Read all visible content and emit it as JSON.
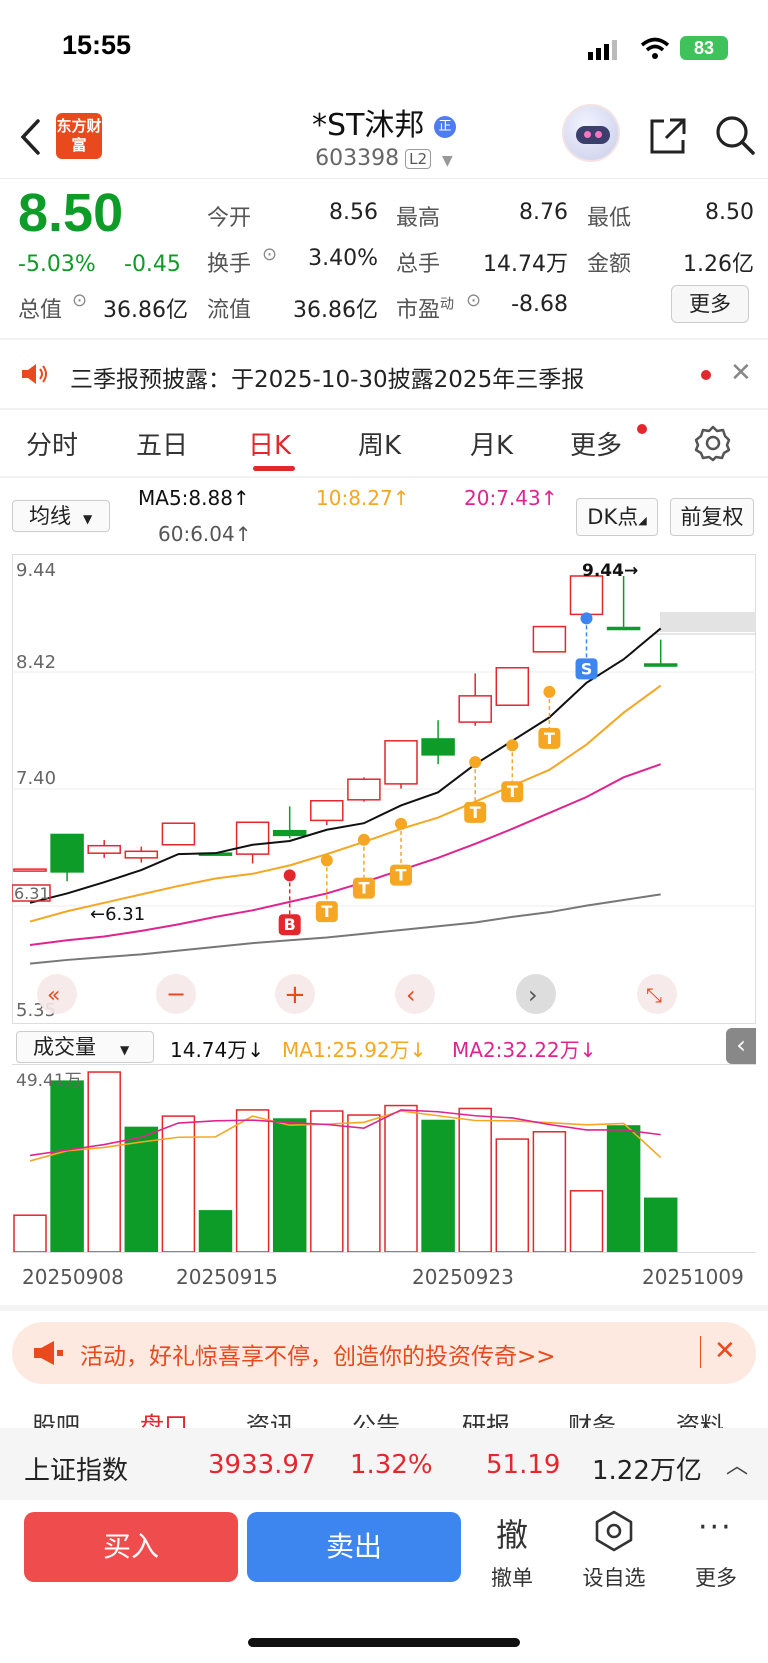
{
  "status_bar": {
    "time": "15:55",
    "battery": "83"
  },
  "header": {
    "logo_text": "东方财富",
    "title": "*ST沐邦",
    "code": "603398",
    "level_badge": "L2"
  },
  "quote": {
    "price": "8.50",
    "change_pct": "-5.03%",
    "change": "-0.45",
    "open_label": "今开",
    "open": "8.56",
    "high_label": "最高",
    "high": "8.76",
    "low_label": "最低",
    "low": "8.50",
    "turnover_label": "换手",
    "turnover": "3.40%",
    "volume_label": "总手",
    "volume": "14.74万",
    "amount_label": "金额",
    "amount": "1.26亿",
    "mktcap_label": "总值",
    "mktcap": "36.86亿",
    "float_label": "流值",
    "float": "36.86亿",
    "pe_label": "市盈",
    "pe_sup": "动",
    "pe": "-8.68",
    "more_label": "更多"
  },
  "notice": {
    "text": "三季报预披露：于2025-10-30披露2025年三季报"
  },
  "tabs": [
    {
      "label": "分时"
    },
    {
      "label": "五日"
    },
    {
      "label": "日K"
    },
    {
      "label": "周K"
    },
    {
      "label": "月K"
    },
    {
      "label": "更多"
    }
  ],
  "kline_toolbar": {
    "ma_select": "均线",
    "ma5": "MA5:8.88↑",
    "ma10": "10:8.27↑",
    "ma20": "20:7.43↑",
    "ma60": "60:6.04↑",
    "dk_button": "DK点",
    "adjust_button": "前复权"
  },
  "kline_labels": {
    "y_top": "9.44",
    "y_2": "8.42",
    "y_3": "7.40",
    "y_bottom": "5.35",
    "y_left_marker": "6.31",
    "min_marker": "←6.31",
    "max_marker": "9.44→"
  },
  "volume_toolbar": {
    "select": "成交量",
    "vol": "14.74万↓",
    "ma1": "MA1:25.92万↓",
    "ma2": "MA2:32.22万↓",
    "vol_max": "49.41万"
  },
  "dates": [
    "20250908",
    "20250915",
    "20250923",
    "20251009"
  ],
  "colors": {
    "up": "#e4262d",
    "down": "#0d9c27",
    "ma5": "#111111",
    "ma10": "#f5a623",
    "ma20": "#e0248f",
    "ma60": "#777777"
  },
  "chart_data": {
    "type": "candlestick",
    "ylim": [
      5.35,
      9.44
    ],
    "candles": [
      {
        "o": 6.31,
        "c": 6.31,
        "h": 6.31,
        "l": 6.31,
        "dir": "up"
      },
      {
        "o": 6.68,
        "c": 6.28,
        "h": 6.68,
        "l": 6.18,
        "dir": "down"
      },
      {
        "o": 6.48,
        "c": 6.56,
        "h": 6.62,
        "l": 6.43,
        "dir": "up"
      },
      {
        "o": 6.43,
        "c": 6.5,
        "h": 6.55,
        "l": 6.38,
        "dir": "up"
      },
      {
        "o": 6.57,
        "c": 6.8,
        "h": 6.8,
        "l": 6.57,
        "dir": "up"
      },
      {
        "o": 6.48,
        "c": 6.48,
        "h": 6.48,
        "l": 6.48,
        "dir": "down"
      },
      {
        "o": 6.47,
        "c": 6.81,
        "h": 6.81,
        "l": 6.37,
        "dir": "up"
      },
      {
        "o": 6.72,
        "c": 6.67,
        "h": 6.98,
        "l": 6.64,
        "dir": "down"
      },
      {
        "o": 6.83,
        "c": 7.04,
        "h": 7.04,
        "l": 6.78,
        "dir": "up"
      },
      {
        "o": 7.05,
        "c": 7.27,
        "h": 7.29,
        "l": 7.03,
        "dir": "up"
      },
      {
        "o": 7.22,
        "c": 7.68,
        "h": 7.68,
        "l": 7.17,
        "dir": "up"
      },
      {
        "o": 7.7,
        "c": 7.53,
        "h": 7.9,
        "l": 7.43,
        "dir": "down"
      },
      {
        "o": 7.88,
        "c": 8.16,
        "h": 8.4,
        "l": 7.84,
        "dir": "up"
      },
      {
        "o": 8.06,
        "c": 8.46,
        "h": 8.46,
        "l": 8.06,
        "dir": "up"
      },
      {
        "o": 8.63,
        "c": 8.9,
        "h": 8.9,
        "l": 8.63,
        "dir": "up"
      },
      {
        "o": 9.03,
        "c": 9.44,
        "h": 9.44,
        "l": 9.03,
        "dir": "up"
      },
      {
        "o": 8.89,
        "c": 8.89,
        "h": 9.44,
        "l": 8.89,
        "dir": "down"
      },
      {
        "o": 8.5,
        "c": 8.5,
        "h": 8.76,
        "l": 8.5,
        "dir": "down"
      }
    ],
    "ma5": [
      5.95,
      6.05,
      6.17,
      6.3,
      6.47,
      6.48,
      6.57,
      6.61,
      6.73,
      6.8,
      6.99,
      7.13,
      7.43,
      7.68,
      7.93,
      8.3,
      8.55,
      8.88
    ],
    "ma10": [
      5.75,
      5.86,
      5.95,
      6.04,
      6.13,
      6.21,
      6.26,
      6.35,
      6.47,
      6.6,
      6.74,
      6.86,
      7.03,
      7.2,
      7.37,
      7.64,
      7.98,
      8.27
    ],
    "ma20": [
      5.5,
      5.55,
      5.59,
      5.65,
      5.72,
      5.8,
      5.87,
      5.96,
      6.05,
      6.17,
      6.3,
      6.43,
      6.58,
      6.74,
      6.91,
      7.08,
      7.29,
      7.43
    ],
    "ma60": [
      5.3,
      5.34,
      5.37,
      5.4,
      5.44,
      5.48,
      5.52,
      5.55,
      5.58,
      5.62,
      5.66,
      5.7,
      5.74,
      5.8,
      5.85,
      5.92,
      5.98,
      6.04
    ],
    "signals": [
      {
        "i": 7,
        "label": "B"
      },
      {
        "i": 8,
        "label": "T"
      },
      {
        "i": 9,
        "label": "T"
      },
      {
        "i": 10,
        "label": "T"
      },
      {
        "i": 12,
        "label": "T"
      },
      {
        "i": 13,
        "label": "T"
      },
      {
        "i": 14,
        "label": "T"
      },
      {
        "i": 15,
        "label": "S"
      }
    ],
    "volume": {
      "ylim": [
        0,
        49.41
      ],
      "values": [
        10.1,
        46.9,
        49.4,
        34.2,
        37.3,
        11.3,
        39.0,
        36.5,
        38.7,
        37.6,
        40.2,
        36.1,
        39.4,
        31.0,
        33.0,
        16.8,
        34.6,
        14.74
      ],
      "dirs": [
        "up",
        "down",
        "up",
        "down",
        "up",
        "down",
        "up",
        "down",
        "up",
        "up",
        "up",
        "down",
        "up",
        "up",
        "up",
        "up",
        "down",
        "down"
      ],
      "ma1": [
        25.0,
        27.8,
        28.7,
        30.2,
        31.5,
        31.6,
        37.3,
        34.8,
        35.1,
        35.6,
        38.7,
        37.4,
        36.1,
        36.0,
        35.5,
        34.9,
        35.3,
        25.92
      ],
      "ma2": [
        26.5,
        28.0,
        29.5,
        31.5,
        35.4,
        36.0,
        36.2,
        35.5,
        35.0,
        34.0,
        39.0,
        38.5,
        37.4,
        36.8,
        35.0,
        33.5,
        33.5,
        32.22
      ]
    }
  },
  "banner": {
    "text": "活动，好礼惊喜享不停，创造你的投资传奇>>"
  },
  "index_bar": {
    "name": "上证指数",
    "value": "3933.97",
    "pct": "1.32%",
    "change": "51.19",
    "amount": "1.22万亿"
  },
  "bottom_bar": {
    "buy": "买入",
    "sell": "卖出",
    "cancel_glyph": "撤",
    "cancel": "撤单",
    "watch": "设自选",
    "more": "更多"
  },
  "hidden_tabs": [
    "股吧",
    "盘口",
    "资讯",
    "公告",
    "研报",
    "财务",
    "资料"
  ]
}
